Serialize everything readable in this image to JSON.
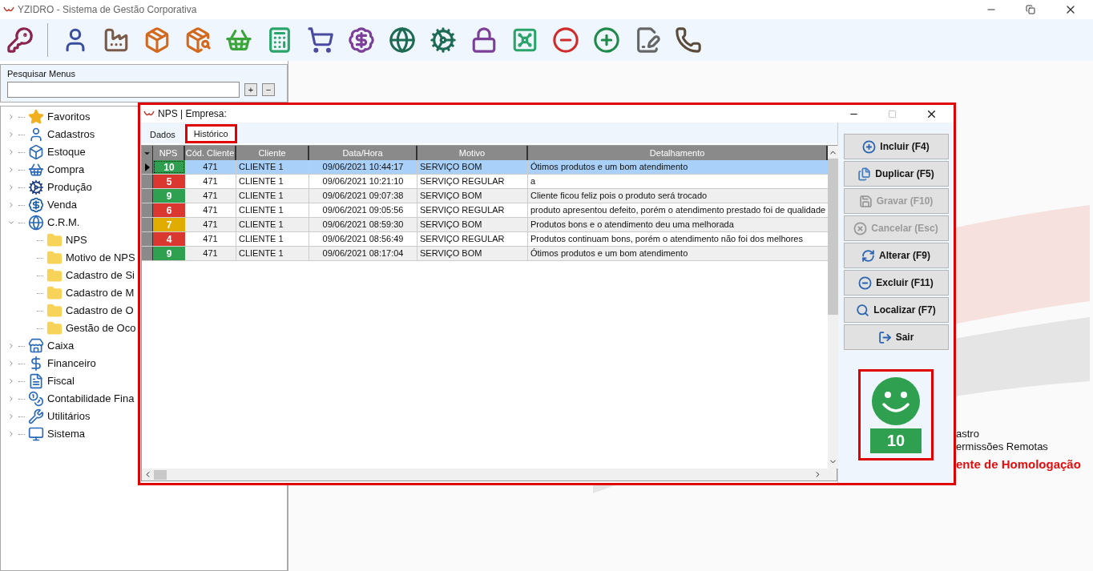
{
  "app": {
    "title": "YZIDRO - Sistema de Gestão Corporativa"
  },
  "sidebar": {
    "search_label": "Pesquisar Menus",
    "expand_all": "+",
    "collapse_all": "−",
    "tree": [
      {
        "label": "Favoritos",
        "expanded": false
      },
      {
        "label": "Cadastros",
        "expanded": false
      },
      {
        "label": "Estoque",
        "expanded": false
      },
      {
        "label": "Compra",
        "expanded": false
      },
      {
        "label": "Produção",
        "expanded": false
      },
      {
        "label": "Venda",
        "expanded": false
      },
      {
        "label": "C.R.M.",
        "expanded": true,
        "children": [
          {
            "label": "NPS"
          },
          {
            "label": "Motivo de NPS"
          },
          {
            "label": "Cadastro de Si"
          },
          {
            "label": "Cadastro de M"
          },
          {
            "label": "Cadastro de O"
          },
          {
            "label": "Gestão de Oco"
          }
        ]
      },
      {
        "label": "Caixa",
        "expanded": false
      },
      {
        "label": "Financeiro",
        "expanded": false
      },
      {
        "label": "Fiscal",
        "expanded": false
      },
      {
        "label": "Contabilidade Fina",
        "expanded": false
      },
      {
        "label": "Utilitários",
        "expanded": false
      },
      {
        "label": "Sistema",
        "expanded": false
      }
    ]
  },
  "background_texts": [
    {
      "text": "astro",
      "kind": "plain"
    },
    {
      "text": "ermissões Remotas",
      "kind": "plain"
    },
    {
      "text": "ente de Homologação",
      "kind": "alert"
    }
  ],
  "dialog": {
    "title": "NPS | Empresa:",
    "tabs": [
      {
        "label": "Dados",
        "selected": false
      },
      {
        "label": "Histórico",
        "selected": true
      }
    ],
    "table": {
      "columns": [
        "NPS",
        "Cód. Cliente",
        "Cliente",
        "Data/Hora",
        "Motivo",
        "Detalhamento"
      ],
      "rows": [
        {
          "nps": "10",
          "color": "#2ea04f",
          "cod": "471",
          "cliente": "CLIENTE 1",
          "data": "09/06/2021 10:44:17",
          "motivo": "SERVIÇO BOM",
          "detalhe": "Ótimos produtos e um bom atendimento",
          "selected": true
        },
        {
          "nps": "5",
          "color": "#d9372f",
          "cod": "471",
          "cliente": "CLIENTE 1",
          "data": "09/06/2021 10:21:10",
          "motivo": "SERVIÇO REGULAR",
          "detalhe": "a",
          "selected": false
        },
        {
          "nps": "9",
          "color": "#2ea04f",
          "cod": "471",
          "cliente": "CLIENTE 1",
          "data": "09/06/2021 09:07:38",
          "motivo": "SERVIÇO BOM",
          "detalhe": "Cliente ficou feliz pois o produto será trocado",
          "selected": false
        },
        {
          "nps": "6",
          "color": "#d9372f",
          "cod": "471",
          "cliente": "CLIENTE 1",
          "data": "09/06/2021 09:05:56",
          "motivo": "SERVIÇO REGULAR",
          "detalhe": "produto apresentou defeito, porém o atendimento prestado foi de qualidade",
          "selected": false
        },
        {
          "nps": "7",
          "color": "#e0ac00",
          "cod": "471",
          "cliente": "CLIENTE 1",
          "data": "09/06/2021 08:59:30",
          "motivo": "SERVIÇO BOM",
          "detalhe": "Produtos bons e o atendimento deu uma melhorada",
          "selected": false
        },
        {
          "nps": "4",
          "color": "#d9372f",
          "cod": "471",
          "cliente": "CLIENTE 1",
          "data": "09/06/2021 08:56:49",
          "motivo": "SERVIÇO REGULAR",
          "detalhe": "Produtos continuam bons, porém o atendimento não foi dos melhores",
          "selected": false
        },
        {
          "nps": "9",
          "color": "#2ea04f",
          "cod": "471",
          "cliente": "CLIENTE 1",
          "data": "09/06/2021 08:17:04",
          "motivo": "SERVIÇO BOM",
          "detalhe": "Ótimos produtos e um bom atendimento",
          "selected": false
        }
      ]
    },
    "buttons": [
      {
        "label": "Incluir (F4)",
        "kind": "add",
        "disabled": false
      },
      {
        "label": "Duplicar (F5)",
        "kind": "copy",
        "disabled": false
      },
      {
        "label": "Gravar (F10)",
        "kind": "save",
        "disabled": true
      },
      {
        "label": "Cancelar (Esc)",
        "kind": "cancel",
        "disabled": true
      },
      {
        "label": "Alterar (F9)",
        "kind": "edit",
        "disabled": false
      },
      {
        "label": "Excluir (F11)",
        "kind": "delete",
        "disabled": false
      },
      {
        "label": "Localizar (F7)",
        "kind": "find",
        "disabled": false
      },
      {
        "label": "Sair",
        "kind": "exit",
        "disabled": false
      }
    ],
    "score": {
      "value": "10",
      "color": "#2ea04f"
    }
  }
}
